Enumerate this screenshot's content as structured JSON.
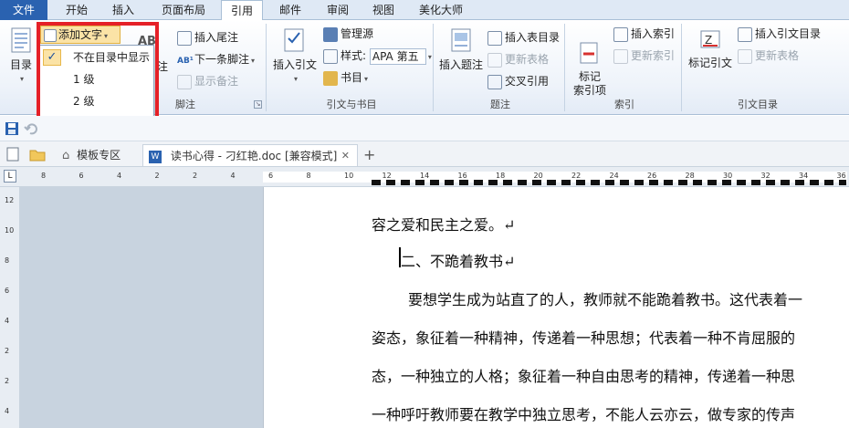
{
  "tabs": [
    "文件",
    "开始",
    "插入",
    "页面布局",
    "引用",
    "邮件",
    "审阅",
    "视图",
    "美化大师"
  ],
  "ribbon": {
    "toc": {
      "label": "目录",
      "add_text": "添加文字",
      "group": ""
    },
    "dropdown": {
      "items": [
        "不在目录中显示",
        "1 级",
        "2 级",
        "3 级"
      ],
      "checked": "✓"
    },
    "footnote": {
      "insert_endnote": "插入尾注",
      "next_footnote": "下一条脚注",
      "show_notes": "显示备注",
      "partial_label": "注",
      "partial_big": "AB",
      "group": "脚注"
    },
    "citations": {
      "insert_citation": "插入引文",
      "manage_sources": "管理源",
      "style_label": "样式:",
      "style_value": "APA 第五",
      "bibliography": "书目",
      "group": "引文与书目"
    },
    "captions": {
      "insert_caption": "插入题注",
      "insert_table_figures": "插入表目录",
      "update_table": "更新表格",
      "cross_reference": "交叉引用",
      "group": "题注"
    },
    "index": {
      "mark_entry": "标记\n索引项",
      "insert_index": "插入索引",
      "update_index": "更新索引",
      "group": "索引"
    },
    "authorities": {
      "mark_citation": "标记引文",
      "insert_toa": "插入引文目录",
      "update_table": "更新表格",
      "group": "引文目录"
    }
  },
  "doctabs": {
    "template_zone": "模板专区",
    "document": "读书心得 - 刁红艳.doc [兼容模式]",
    "close": "✕",
    "add": "+"
  },
  "ruler_h": [
    "8",
    "6",
    "4",
    "2",
    "2",
    "4",
    "6",
    "8",
    "10",
    "12",
    "14",
    "16",
    "18",
    "20",
    "22",
    "24",
    "26",
    "28",
    "30",
    "32",
    "34",
    "36"
  ],
  "ruler_v": [
    "12",
    "10",
    "8",
    "6",
    "4",
    "2",
    "2",
    "4"
  ],
  "document": {
    "lines": [
      "容之爱和民主之爱。↵",
      "二、不跪着教书↵",
      "要想学生成为站直了的人，教师就不能跪着教书。这代表着一",
      "姿态，象征着一种精神，传递着一种思想；代表着一种不肯屈服的",
      "态，一种独立的人格；象征着一种自由思考的精神，传递着一种思",
      "一种呼吁教师要在教学中独立思考，不能人云亦云，做专家的传声"
    ]
  },
  "colors": {
    "file_tab": "#2a62b0",
    "highlight": "#e52027",
    "selection": "#fbe3a6"
  }
}
